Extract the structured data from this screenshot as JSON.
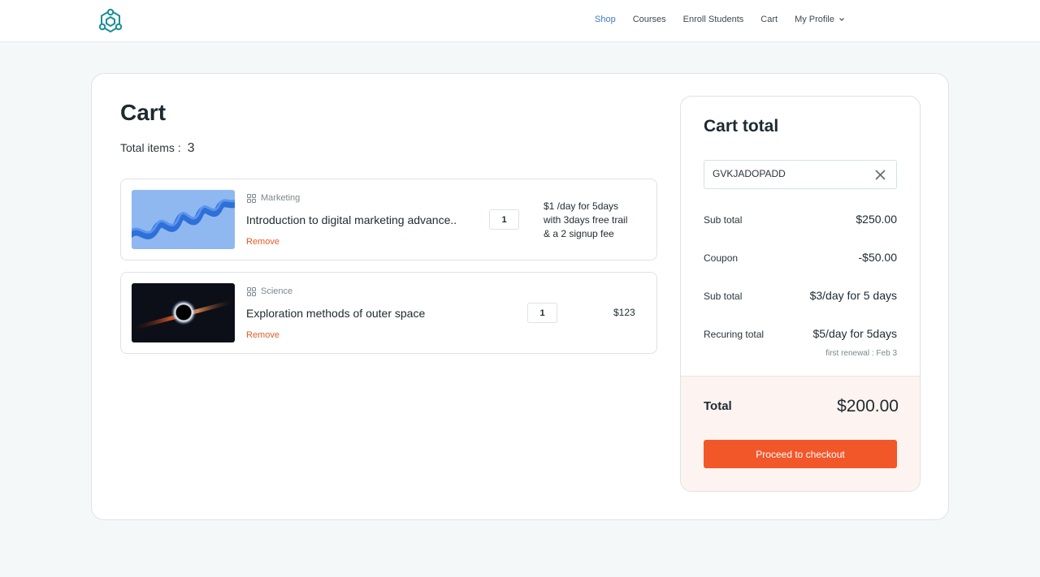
{
  "nav": {
    "items": [
      {
        "label": "Shop",
        "active": true
      },
      {
        "label": "Courses"
      },
      {
        "label": "Enroll Students"
      },
      {
        "label": "Cart"
      },
      {
        "label": "My Profile"
      }
    ],
    "logo_icon": "hexagon-network-icon",
    "accent": "#3f78c7"
  },
  "cart": {
    "title": "Cart",
    "total_items_label": "Total items :",
    "total_items_count": "3",
    "items": [
      {
        "category": "Marketing",
        "title": "Introduction to digital marketing advance..",
        "remove_label": "Remove",
        "quantity": "1",
        "price_lines": [
          "$1 /day for 5days",
          "with 3days free trail",
          "& a 2 signup fee"
        ]
      },
      {
        "category": "Science",
        "title": "Exploration methods of outer space",
        "remove_label": "Remove",
        "quantity": "1",
        "price": "$123"
      }
    ]
  },
  "summary": {
    "title": "Cart total",
    "coupon_code": "GVKJADOPADD",
    "rows": [
      {
        "label": "Sub total",
        "value": "$250.00"
      },
      {
        "label": "Coupon",
        "value": "-$50.00"
      },
      {
        "label": "Sub total",
        "value": "$3/day for 5 days"
      },
      {
        "label": "Recuring total",
        "value": "$5/day for 5days"
      }
    ],
    "renewal_note": "first renewal : Feb 3",
    "total_label": "Total",
    "total_value": "$200.00",
    "checkout_label": "Proceed to checkout"
  },
  "colors": {
    "primary_button": "#f2572a",
    "remove_link": "#e65a2b",
    "total_box_bg": "#fdf3f0"
  }
}
